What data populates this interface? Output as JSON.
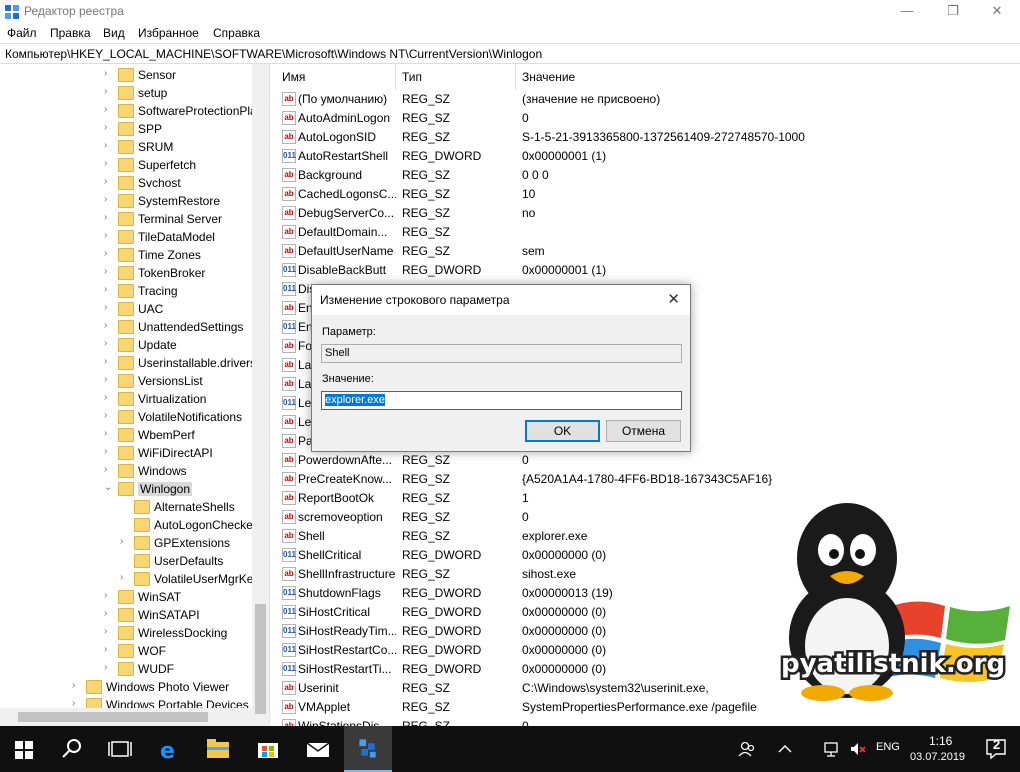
{
  "window": {
    "title": "Редактор реестра",
    "minimize": "—",
    "maximize": "❐",
    "close": "✕"
  },
  "menu": [
    "Файл",
    "Правка",
    "Вид",
    "Избранное",
    "Справка"
  ],
  "address": "Компьютер\\HKEY_LOCAL_MACHINE\\SOFTWARE\\Microsoft\\Windows NT\\CurrentVersion\\Winlogon",
  "tree": [
    {
      "label": "Sensor",
      "level": 0,
      "expander": "›"
    },
    {
      "label": "setup",
      "level": 0,
      "expander": "›"
    },
    {
      "label": "SoftwareProtectionPla",
      "level": 0,
      "expander": "›"
    },
    {
      "label": "SPP",
      "level": 0,
      "expander": "›"
    },
    {
      "label": "SRUM",
      "level": 0,
      "expander": "›"
    },
    {
      "label": "Superfetch",
      "level": 0,
      "expander": "›"
    },
    {
      "label": "Svchost",
      "level": 0,
      "expander": "›"
    },
    {
      "label": "SystemRestore",
      "level": 0,
      "expander": "›"
    },
    {
      "label": "Terminal Server",
      "level": 0,
      "expander": "›"
    },
    {
      "label": "TileDataModel",
      "level": 0,
      "expander": "›"
    },
    {
      "label": "Time Zones",
      "level": 0,
      "expander": "›"
    },
    {
      "label": "TokenBroker",
      "level": 0,
      "expander": "›"
    },
    {
      "label": "Tracing",
      "level": 0,
      "expander": "›"
    },
    {
      "label": "UAC",
      "level": 0,
      "expander": "›"
    },
    {
      "label": "UnattendedSettings",
      "level": 0,
      "expander": "›"
    },
    {
      "label": "Update",
      "level": 0,
      "expander": "›"
    },
    {
      "label": "Userinstallable.drivers",
      "level": 0,
      "expander": "›"
    },
    {
      "label": "VersionsList",
      "level": 0,
      "expander": "›"
    },
    {
      "label": "Virtualization",
      "level": 0,
      "expander": "›"
    },
    {
      "label": "VolatileNotifications",
      "level": 0,
      "expander": "›"
    },
    {
      "label": "WbemPerf",
      "level": 0,
      "expander": "›"
    },
    {
      "label": "WiFiDirectAPI",
      "level": 0,
      "expander": "›"
    },
    {
      "label": "Windows",
      "level": 0,
      "expander": "›"
    },
    {
      "label": "Winlogon",
      "level": 0,
      "expander": "⌄",
      "selected": true
    },
    {
      "label": "AlternateShells",
      "level": 1,
      "expander": ""
    },
    {
      "label": "AutoLogonChecke",
      "level": 1,
      "expander": ""
    },
    {
      "label": "GPExtensions",
      "level": 1,
      "expander": "›"
    },
    {
      "label": "UserDefaults",
      "level": 1,
      "expander": ""
    },
    {
      "label": "VolatileUserMgrKe",
      "level": 1,
      "expander": "›"
    },
    {
      "label": "WinSAT",
      "level": 0,
      "expander": "›"
    },
    {
      "label": "WinSATAPI",
      "level": 0,
      "expander": "›"
    },
    {
      "label": "WirelessDocking",
      "level": 0,
      "expander": "›"
    },
    {
      "label": "WOF",
      "level": 0,
      "expander": "›"
    },
    {
      "label": "WUDF",
      "level": 0,
      "expander": "›"
    },
    {
      "label": "Windows Photo Viewer",
      "level": -1,
      "expander": "›"
    },
    {
      "label": "Windows Portable Devices",
      "level": -1,
      "expander": "›"
    }
  ],
  "columns": {
    "name": "Имя",
    "type": "Тип",
    "data": "Значение"
  },
  "values": [
    {
      "name": "(По умолчанию)",
      "type": "REG_SZ",
      "data": "(значение не присвоено)",
      "icon": "ab"
    },
    {
      "name": "AutoAdminLogon",
      "type": "REG_SZ",
      "data": "0",
      "icon": "ab"
    },
    {
      "name": "AutoLogonSID",
      "type": "REG_SZ",
      "data": "S-1-5-21-3913365800-1372561409-272748570-1000",
      "icon": "ab"
    },
    {
      "name": "AutoRestartShell",
      "type": "REG_DWORD",
      "data": "0x00000001 (1)",
      "icon": "011"
    },
    {
      "name": "Background",
      "type": "REG_SZ",
      "data": "0 0 0",
      "icon": "ab"
    },
    {
      "name": "CachedLogonsC...",
      "type": "REG_SZ",
      "data": "10",
      "icon": "ab"
    },
    {
      "name": "DebugServerCo...",
      "type": "REG_SZ",
      "data": "no",
      "icon": "ab"
    },
    {
      "name": "DefaultDomain...",
      "type": "REG_SZ",
      "data": "",
      "icon": "ab"
    },
    {
      "name": "DefaultUserName",
      "type": "REG_SZ",
      "data": "sem",
      "icon": "ab"
    },
    {
      "name": "DisableBackButt",
      "type": "REG_DWORD",
      "data": "0x00000001 (1)",
      "icon": "011"
    },
    {
      "name": "Dis",
      "type": "",
      "data": "",
      "icon": "011"
    },
    {
      "name": "En",
      "type": "",
      "data": "",
      "icon": "ab"
    },
    {
      "name": "En",
      "type": "",
      "data": "",
      "icon": "011"
    },
    {
      "name": "Fo",
      "type": "",
      "data": "",
      "icon": "ab"
    },
    {
      "name": "La",
      "type": "",
      "data": "",
      "icon": "ab"
    },
    {
      "name": "La",
      "type": "",
      "data": "",
      "icon": "ab"
    },
    {
      "name": "Le",
      "type": "",
      "data": "",
      "icon": "011"
    },
    {
      "name": "Le",
      "type": "",
      "data": "",
      "icon": "ab"
    },
    {
      "name": "Pa",
      "type": "",
      "data": "",
      "icon": "ab"
    },
    {
      "name": "PowerdownAfte...",
      "type": "REG_SZ",
      "data": "0",
      "icon": "ab"
    },
    {
      "name": "PreCreateKnow...",
      "type": "REG_SZ",
      "data": "{A520A1A4-1780-4FF6-BD18-167343C5AF16}",
      "icon": "ab"
    },
    {
      "name": "ReportBootOk",
      "type": "REG_SZ",
      "data": "1",
      "icon": "ab"
    },
    {
      "name": "scremoveoption",
      "type": "REG_SZ",
      "data": "0",
      "icon": "ab"
    },
    {
      "name": "Shell",
      "type": "REG_SZ",
      "data": "explorer.exe",
      "icon": "ab"
    },
    {
      "name": "ShellCritical",
      "type": "REG_DWORD",
      "data": "0x00000000 (0)",
      "icon": "011"
    },
    {
      "name": "ShellInfrastructure",
      "type": "REG_SZ",
      "data": "sihost.exe",
      "icon": "ab"
    },
    {
      "name": "ShutdownFlags",
      "type": "REG_DWORD",
      "data": "0x00000013 (19)",
      "icon": "011"
    },
    {
      "name": "SiHostCritical",
      "type": "REG_DWORD",
      "data": "0x00000000 (0)",
      "icon": "011"
    },
    {
      "name": "SiHostReadyTim...",
      "type": "REG_DWORD",
      "data": "0x00000000 (0)",
      "icon": "011"
    },
    {
      "name": "SiHostRestartCo...",
      "type": "REG_DWORD",
      "data": "0x00000000 (0)",
      "icon": "011"
    },
    {
      "name": "SiHostRestartTi...",
      "type": "REG_DWORD",
      "data": "0x00000000 (0)",
      "icon": "011"
    },
    {
      "name": "Userinit",
      "type": "REG_SZ",
      "data": "C:\\Windows\\system32\\userinit.exe,",
      "icon": "ab"
    },
    {
      "name": "VMApplet",
      "type": "REG_SZ",
      "data": "SystemPropertiesPerformance.exe /pagefile",
      "icon": "ab"
    },
    {
      "name": "WinStationsDis...",
      "type": "REG_SZ",
      "data": "0",
      "icon": "ab"
    }
  ],
  "dialog": {
    "title": "Изменение строкового параметра",
    "param_label": "Параметр:",
    "param_value": "Shell",
    "value_label": "Значение:",
    "value_value": "explorer.exe",
    "ok": "OK",
    "cancel": "Отмена",
    "close": "✕"
  },
  "watermark": {
    "text": "pyatilistnik.org"
  },
  "taskbar": {
    "time": "1:16",
    "date": "03.07.2019",
    "lang": "ENG",
    "notifications": "2"
  }
}
